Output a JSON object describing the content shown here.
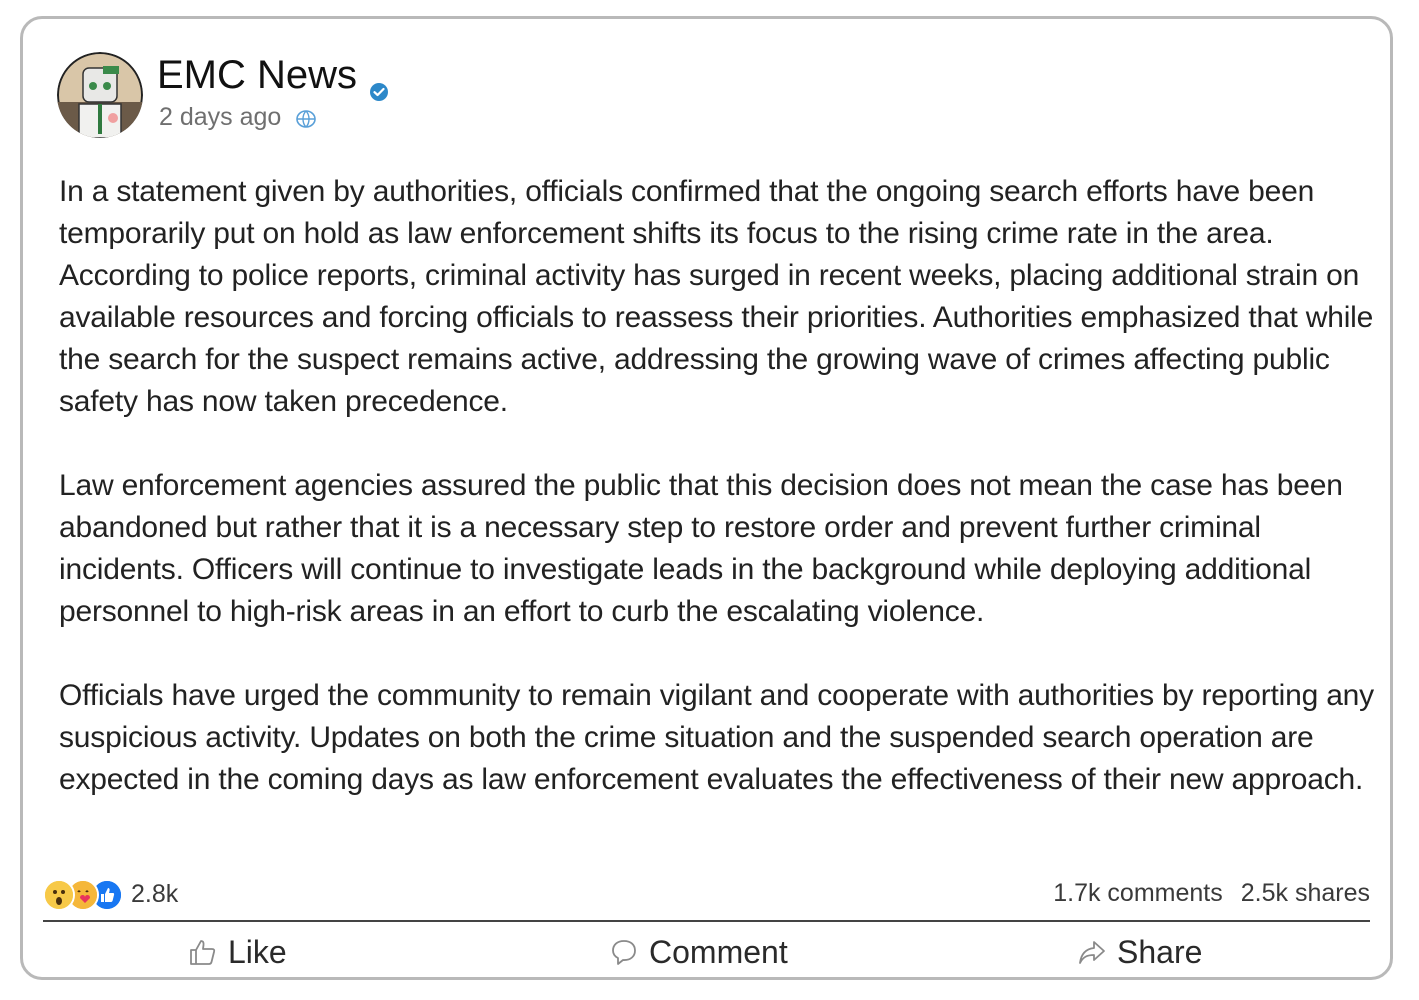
{
  "post": {
    "page_name": "EMC News",
    "timestamp": "2 days ago",
    "audience_icon": "globe-icon",
    "verified_icon": "verified-badge-icon",
    "paragraphs": [
      "In a statement given by authorities, officials confirmed that the ongoing search efforts have been temporarily put on hold as law enforcement shifts its focus to the rising crime rate in the area. According to police reports, criminal activity has surged in recent weeks, placing additional strain on available resources and forcing officials to reassess their priorities. Authorities emphasized that while the search for the suspect remains active, addressing the growing wave of crimes affecting public safety has now taken precedence.",
      "Law enforcement agencies assured the public that this decision does not mean the case has been abandoned but rather that it is a necessary step to restore order and prevent further criminal incidents. Officers will continue to investigate leads in the background while deploying additional personnel to high-risk areas in an effort to curb the escalating violence.",
      "Officials have urged the community to remain vigilant and cooperate with authorities by reporting any suspicious activity. Updates on both the crime situation and the suspended search operation are expected in the coming days as law enforcement evaluates the effectiveness of their new approach."
    ]
  },
  "engagement": {
    "reaction_icons": [
      "wow-reaction-icon",
      "care-reaction-icon",
      "like-reaction-icon"
    ],
    "reaction_count": "2.8k",
    "comments": "1.7k comments",
    "shares": "2.5k shares"
  },
  "actions": {
    "like_label": "Like",
    "comment_label": "Comment",
    "share_label": "Share"
  },
  "colors": {
    "verified": "#2d88c9",
    "like_blue": "#1877f2",
    "border": "#b9b9b9"
  }
}
